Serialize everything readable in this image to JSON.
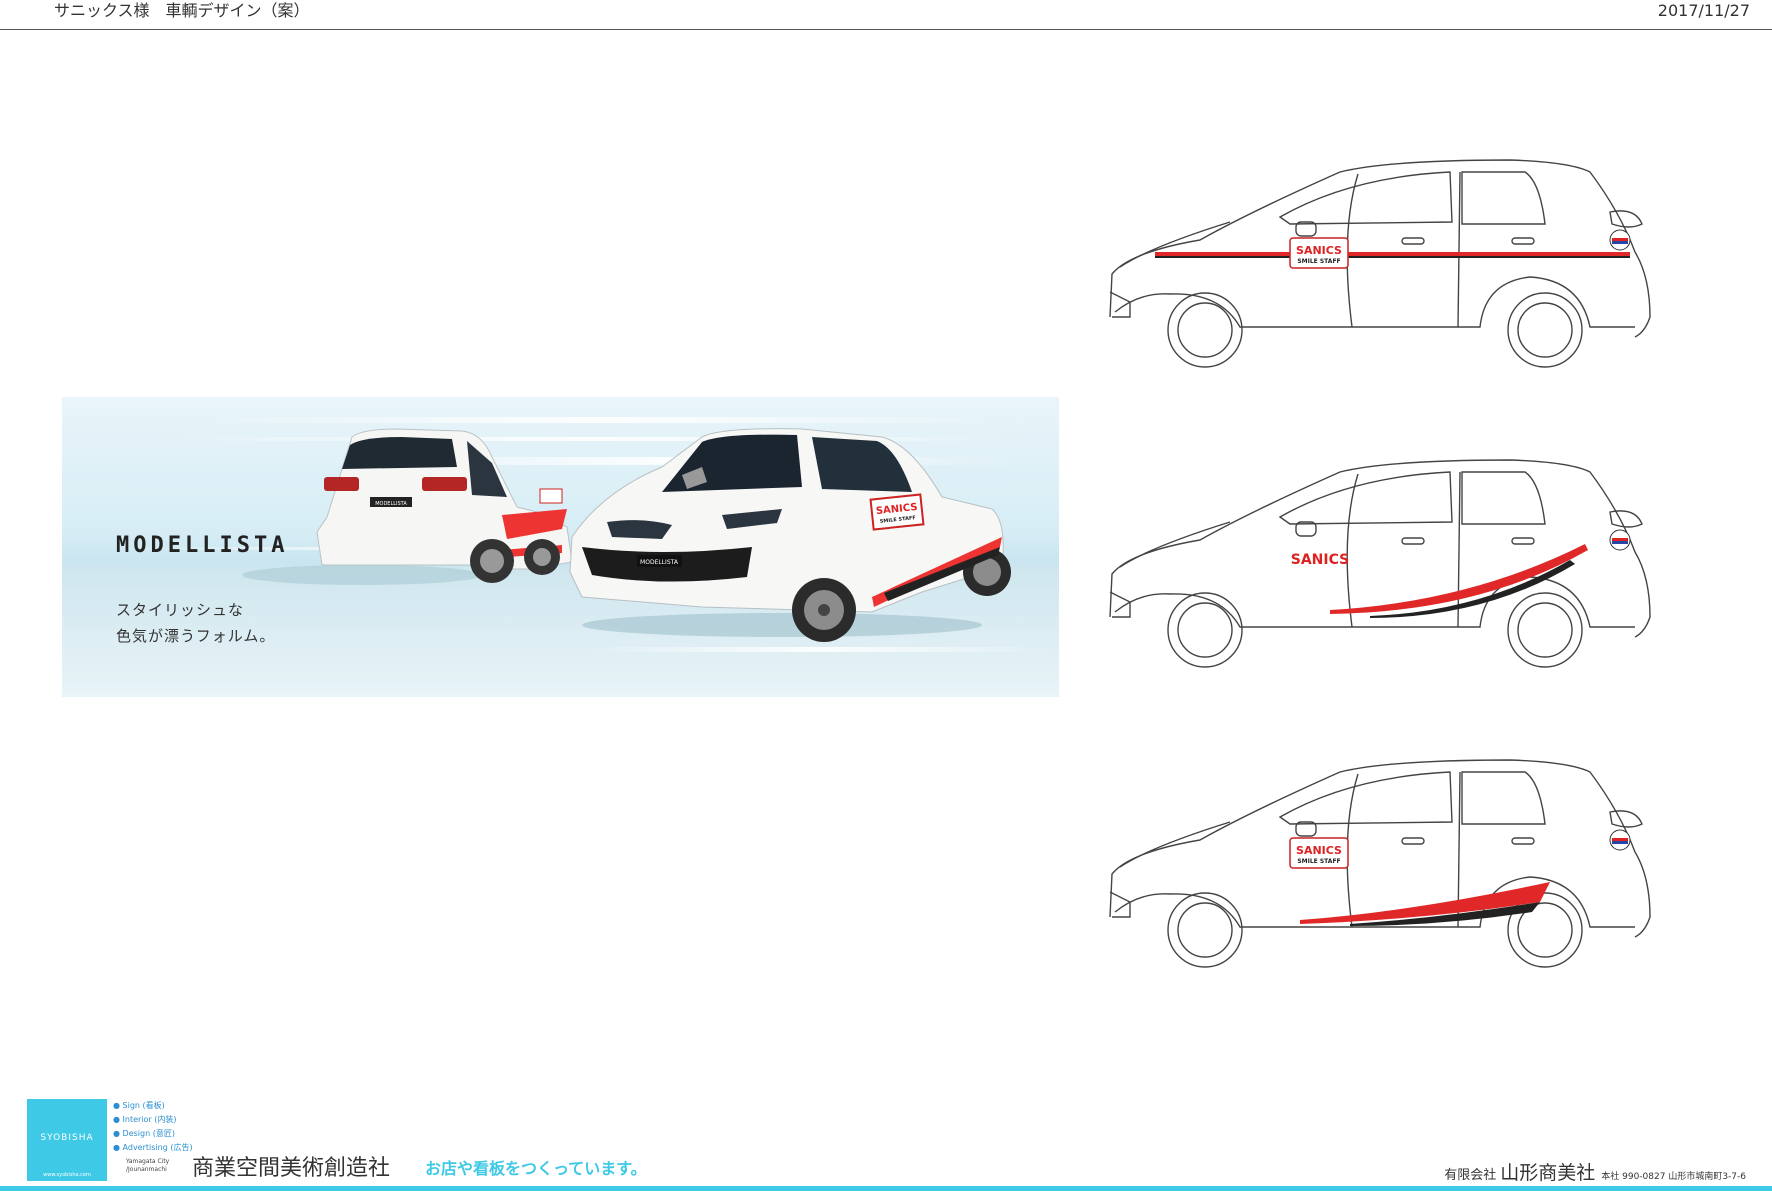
{
  "header": {
    "title": "サニックス様　車輌デザイン（案）",
    "date": "2017/11/27"
  },
  "banner": {
    "brand": "MODELLISTA",
    "copy_line1": "スタイリッシュな",
    "copy_line2": "色気が漂うフォルム。",
    "rear_plate": "MODELLISTA",
    "front_plate": "MODELLISTA"
  },
  "decal": {
    "logo": "SANICS",
    "sub": "SMILE STAFF"
  },
  "colors": {
    "accent_red": "#e02828",
    "stripe_black": "#222222",
    "brand_cyan": "#3ec9e6"
  },
  "footer": {
    "logo_text": "SYOBISHA",
    "logo_url": "www.syobisha.com",
    "services": [
      "Sign (看板)",
      "Interior (内装)",
      "Design (意匠)",
      "Advertising (広告)"
    ],
    "city": "Yamagata City",
    "city_sub": "/Jounanmachi",
    "company": "商業空間美術創造社",
    "tagline": "お店や看板をつくっています。",
    "company_kind": "有限会社",
    "company_name": "山形商美社",
    "address": "本社 990-0827  山形市城南町3-7-6"
  }
}
